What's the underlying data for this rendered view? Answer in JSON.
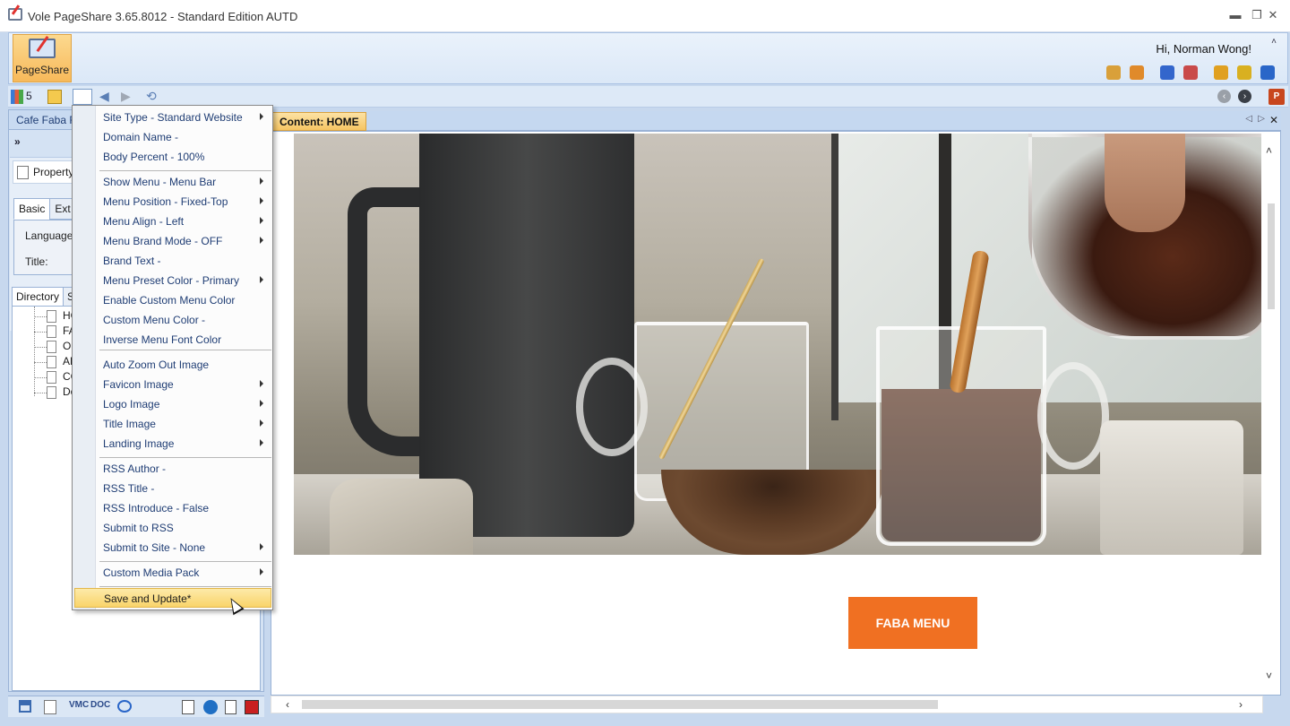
{
  "window": {
    "title": "Vole PageShare  3.65.8012 - Standard Edition AUTD",
    "minimize": "▬",
    "maximize": "❐",
    "close": "✕"
  },
  "ribbon": {
    "pageshare_label": "PageShare",
    "greeting": "Hi, Norman Wong!",
    "collapse": "˄",
    "icons": [
      "palette-icon",
      "rocket-icon",
      "shield-icon",
      "badge-icon",
      "tools-icon",
      "timer-icon",
      "info-icon"
    ],
    "icon_colors": [
      "#d9a03a",
      "#e08a2a",
      "#3366cc",
      "#c94a4a",
      "#e0a020",
      "#d9b020",
      "#2a66c8"
    ]
  },
  "toolbar": {
    "count": "5",
    "back": "◀",
    "forward": "▶",
    "refresh": "⟲",
    "nav_prev": "‹",
    "nav_next": "›",
    "ppt": "P"
  },
  "left_pane": {
    "header": "Cafe Faba Restaurant",
    "expand": "»",
    "properties_label": "Property",
    "subtabs": [
      "Basic",
      "Ext"
    ],
    "fields": [
      "Language",
      "Title:"
    ],
    "dir_tabs": [
      "Directory",
      "S"
    ],
    "tree_items": [
      "HOME",
      "FABA MENU",
      "OUR STORY",
      "ABOUT",
      "CONTACT",
      "Download"
    ]
  },
  "bottom_bar": {
    "labels": [
      "VMC",
      "DOC"
    ]
  },
  "content": {
    "tab_label": "Content: HOME",
    "prev": "◁",
    "next": "▷",
    "close": "✕",
    "button_label": "FABA MENU",
    "accent": "#f07022",
    "scroll_up": "˄",
    "scroll_down": "˅",
    "scroll_left": "‹",
    "scroll_right": "›"
  },
  "menu": {
    "items": [
      {
        "label": "Site Type - Standard Website",
        "submenu": true
      },
      {
        "label": "Domain Name -",
        "submenu": false
      },
      {
        "label": "Body Percent - 100%",
        "submenu": false
      },
      {
        "label": "Show Menu - Menu Bar",
        "submenu": true
      },
      {
        "label": "Menu Position - Fixed-Top",
        "submenu": true
      },
      {
        "label": "Menu Align - Left",
        "submenu": true
      },
      {
        "label": "Menu Brand Mode - OFF",
        "submenu": true
      },
      {
        "label": "Brand Text -",
        "submenu": false
      },
      {
        "label": "Menu Preset Color - Primary",
        "submenu": true
      },
      {
        "label": "Enable Custom Menu Color",
        "submenu": false
      },
      {
        "label": "Custom Menu Color -",
        "submenu": false
      },
      {
        "label": "Inverse Menu Font Color",
        "submenu": false
      },
      {
        "label": "Auto Zoom Out Image",
        "submenu": false
      },
      {
        "label": "Favicon Image",
        "submenu": true
      },
      {
        "label": "Logo Image",
        "submenu": true
      },
      {
        "label": "Title Image",
        "submenu": true
      },
      {
        "label": "Landing Image",
        "submenu": true
      },
      {
        "label": "RSS Author -",
        "submenu": false
      },
      {
        "label": "RSS Title -",
        "submenu": false
      },
      {
        "label": "RSS Introduce - False",
        "submenu": false
      },
      {
        "label": "Submit to RSS",
        "submenu": false
      },
      {
        "label": "Submit to Site - None",
        "submenu": true
      },
      {
        "label": "Custom Media Pack",
        "submenu": true
      },
      {
        "label": "Save and Update*",
        "submenu": false
      }
    ]
  }
}
